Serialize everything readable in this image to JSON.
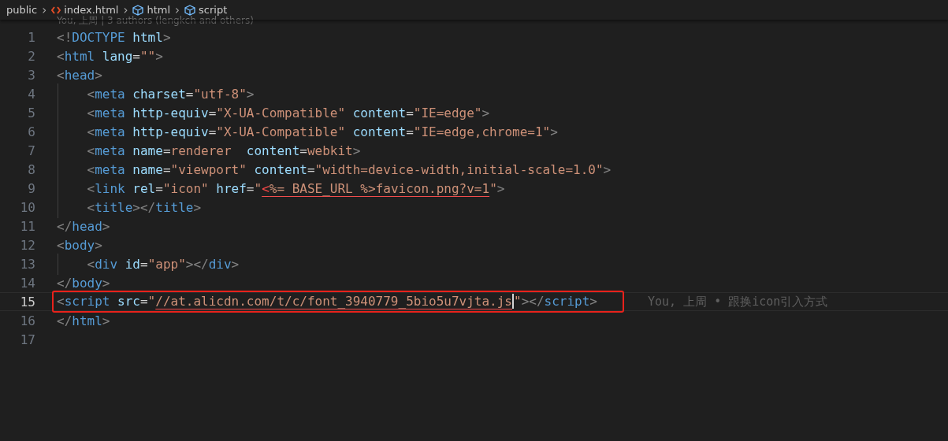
{
  "breadcrumbs": [
    {
      "label": "public",
      "kind": "folder"
    },
    {
      "separator": "›",
      "label": "index.html",
      "kind": "file"
    },
    {
      "separator": "›",
      "label": "html",
      "kind": "symbol"
    },
    {
      "separator": "›",
      "label": "script",
      "kind": "symbol"
    }
  ],
  "codelens": "You, 上周 | 3 authors (lengkch and others)",
  "lines": [
    {
      "number": "1",
      "current": false,
      "tokens": [
        {
          "kind": "punct",
          "text": "<!"
        },
        {
          "kind": "tag",
          "text": "DOCTYPE"
        },
        {
          "kind": "attr",
          "text": " html"
        },
        {
          "kind": "punct",
          "text": ">"
        }
      ]
    },
    {
      "number": "2",
      "current": false,
      "tokens": [
        {
          "kind": "punct",
          "text": "<"
        },
        {
          "kind": "tag",
          "text": "html"
        },
        {
          "kind": "attr",
          "text": " lang"
        },
        {
          "kind": "text",
          "text": "="
        },
        {
          "kind": "string",
          "text": "\"\""
        },
        {
          "kind": "punct",
          "text": ">"
        }
      ]
    },
    {
      "number": "3",
      "current": false,
      "tokens": [
        {
          "kind": "punct",
          "text": "<"
        },
        {
          "kind": "tag",
          "text": "head"
        },
        {
          "kind": "punct",
          "text": ">"
        }
      ]
    },
    {
      "number": "4",
      "current": false,
      "tokens": [
        {
          "kind": "punct",
          "text": "    <"
        },
        {
          "kind": "tag",
          "text": "meta"
        },
        {
          "kind": "attr",
          "text": " charset"
        },
        {
          "kind": "text",
          "text": "="
        },
        {
          "kind": "string",
          "text": "\"utf-8\""
        },
        {
          "kind": "punct",
          "text": ">"
        }
      ]
    },
    {
      "number": "5",
      "current": false,
      "tokens": [
        {
          "kind": "punct",
          "text": "    <"
        },
        {
          "kind": "tag",
          "text": "meta"
        },
        {
          "kind": "attr",
          "text": " http-equiv"
        },
        {
          "kind": "text",
          "text": "="
        },
        {
          "kind": "string",
          "text": "\"X-UA-Compatible\""
        },
        {
          "kind": "attr",
          "text": " content"
        },
        {
          "kind": "text",
          "text": "="
        },
        {
          "kind": "string",
          "text": "\"IE=edge\""
        },
        {
          "kind": "punct",
          "text": ">"
        }
      ]
    },
    {
      "number": "6",
      "current": false,
      "tokens": [
        {
          "kind": "punct",
          "text": "    <"
        },
        {
          "kind": "tag",
          "text": "meta"
        },
        {
          "kind": "attr",
          "text": " http-equiv"
        },
        {
          "kind": "text",
          "text": "="
        },
        {
          "kind": "string",
          "text": "\"X-UA-Compatible\""
        },
        {
          "kind": "attr",
          "text": " content"
        },
        {
          "kind": "text",
          "text": "="
        },
        {
          "kind": "string",
          "text": "\"IE=edge,chrome=1\""
        },
        {
          "kind": "punct",
          "text": ">"
        }
      ]
    },
    {
      "number": "7",
      "current": false,
      "tokens": [
        {
          "kind": "punct",
          "text": "    <"
        },
        {
          "kind": "tag",
          "text": "meta"
        },
        {
          "kind": "attr",
          "text": " name"
        },
        {
          "kind": "text",
          "text": "="
        },
        {
          "kind": "string",
          "text": "renderer"
        },
        {
          "kind": "attr",
          "text": "  content"
        },
        {
          "kind": "text",
          "text": "="
        },
        {
          "kind": "string",
          "text": "webkit"
        },
        {
          "kind": "punct",
          "text": ">"
        }
      ]
    },
    {
      "number": "8",
      "current": false,
      "tokens": [
        {
          "kind": "punct",
          "text": "    <"
        },
        {
          "kind": "tag",
          "text": "meta"
        },
        {
          "kind": "attr",
          "text": " name"
        },
        {
          "kind": "text",
          "text": "="
        },
        {
          "kind": "string",
          "text": "\"viewport\""
        },
        {
          "kind": "attr",
          "text": " content"
        },
        {
          "kind": "text",
          "text": "="
        },
        {
          "kind": "string",
          "text": "\"width=device-width,initial-scale=1.0\""
        },
        {
          "kind": "punct",
          "text": ">"
        }
      ]
    },
    {
      "number": "9",
      "current": false,
      "tokens": [
        {
          "kind": "punct",
          "text": "    <"
        },
        {
          "kind": "tag",
          "text": "link"
        },
        {
          "kind": "attr",
          "text": " rel"
        },
        {
          "kind": "text",
          "text": "="
        },
        {
          "kind": "string",
          "text": "\"icon\""
        },
        {
          "kind": "attr",
          "text": " href"
        },
        {
          "kind": "text",
          "text": "="
        },
        {
          "kind": "string",
          "text": "\""
        },
        {
          "kind": "error",
          "text": "<",
          "underline": true
        },
        {
          "kind": "string",
          "text": "%= BASE_URL %>favicon.png?v=1",
          "underline": true
        },
        {
          "kind": "string",
          "text": "\""
        },
        {
          "kind": "punct",
          "text": ">"
        }
      ]
    },
    {
      "number": "10",
      "current": false,
      "tokens": [
        {
          "kind": "punct",
          "text": "    <"
        },
        {
          "kind": "tag",
          "text": "title"
        },
        {
          "kind": "punct",
          "text": "></"
        },
        {
          "kind": "tag",
          "text": "title"
        },
        {
          "kind": "punct",
          "text": ">"
        }
      ]
    },
    {
      "number": "11",
      "current": false,
      "tokens": [
        {
          "kind": "punct",
          "text": "</"
        },
        {
          "kind": "tag",
          "text": "head"
        },
        {
          "kind": "punct",
          "text": ">"
        }
      ]
    },
    {
      "number": "12",
      "current": false,
      "tokens": [
        {
          "kind": "punct",
          "text": "<"
        },
        {
          "kind": "tag",
          "text": "body"
        },
        {
          "kind": "punct",
          "text": ">"
        }
      ]
    },
    {
      "number": "13",
      "current": false,
      "tokens": [
        {
          "kind": "punct",
          "text": "    <"
        },
        {
          "kind": "tag",
          "text": "div"
        },
        {
          "kind": "attr",
          "text": " id"
        },
        {
          "kind": "text",
          "text": "="
        },
        {
          "kind": "string",
          "text": "\"app\""
        },
        {
          "kind": "punct",
          "text": "></"
        },
        {
          "kind": "tag",
          "text": "div"
        },
        {
          "kind": "punct",
          "text": ">"
        }
      ]
    },
    {
      "number": "14",
      "current": false,
      "tokens": [
        {
          "kind": "punct",
          "text": "</"
        },
        {
          "kind": "tag",
          "text": "body"
        },
        {
          "kind": "punct",
          "text": ">"
        }
      ]
    },
    {
      "number": "15",
      "current": true,
      "annotated": true,
      "blame": "You, 上周 • 跟换icon引入方式",
      "tokens": [
        {
          "kind": "punct",
          "text": "<"
        },
        {
          "kind": "tag",
          "text": "script"
        },
        {
          "kind": "attr",
          "text": " src"
        },
        {
          "kind": "text",
          "text": "="
        },
        {
          "kind": "string",
          "text": "\""
        },
        {
          "kind": "string",
          "text": "//at.alicdn.com/t/c/font_3940779_5bio5u7vjta.js",
          "underline": true,
          "caret": true
        },
        {
          "kind": "string",
          "text": "\""
        },
        {
          "kind": "punct",
          "text": "></"
        },
        {
          "kind": "tag",
          "text": "script"
        },
        {
          "kind": "punct",
          "text": ">"
        }
      ]
    },
    {
      "number": "16",
      "current": false,
      "tokens": [
        {
          "kind": "punct",
          "text": "</"
        },
        {
          "kind": "tag",
          "text": "html"
        },
        {
          "kind": "punct",
          "text": ">"
        }
      ]
    },
    {
      "number": "17",
      "current": false
    }
  ]
}
